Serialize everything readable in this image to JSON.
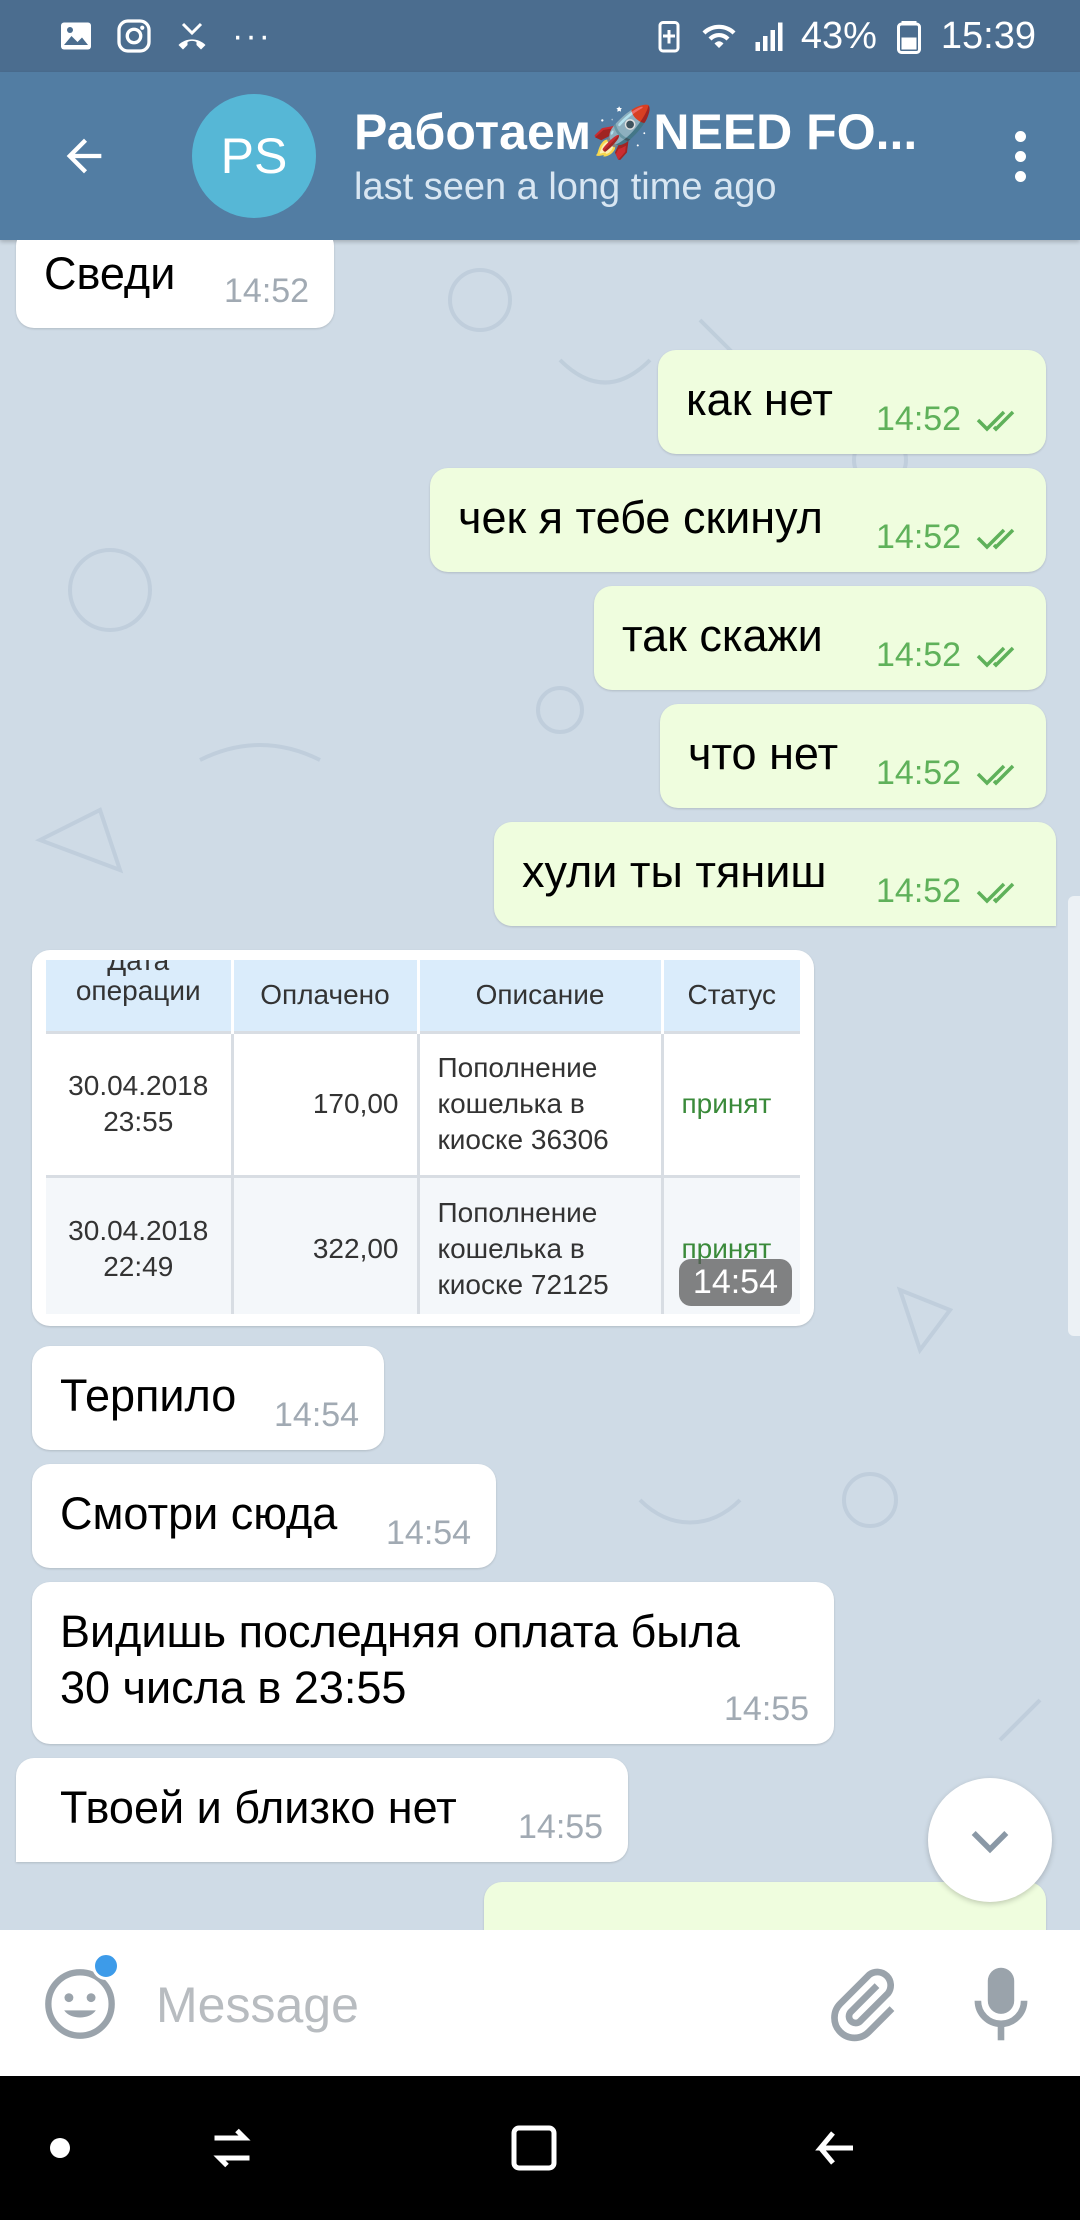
{
  "status_bar": {
    "battery_percent": "43%",
    "time": "15:39",
    "more": "···"
  },
  "header": {
    "avatar_initials": "PS",
    "title": "Работаем🚀NEED FO...",
    "subtitle": "last seen a long time ago"
  },
  "messages": [
    {
      "dir": "in",
      "text": "Сведи",
      "time": "14:52"
    },
    {
      "dir": "out",
      "text": "как нет",
      "time": "14:52"
    },
    {
      "dir": "out",
      "text": "чек я тебе скинул",
      "time": "14:52"
    },
    {
      "dir": "out",
      "text": "так скажи",
      "time": "14:52"
    },
    {
      "dir": "out",
      "text": "что нет",
      "time": "14:52"
    },
    {
      "dir": "out",
      "text": "хули ты тяниш",
      "time": "14:52"
    },
    {
      "dir": "in",
      "text": "Терпило",
      "time": "14:54"
    },
    {
      "dir": "in",
      "text": "Смотри сюда",
      "time": "14:54"
    },
    {
      "dir": "in",
      "text": "Видишь последняя оплата была",
      "text2": "30 числа в 23:55",
      "time": "14:55"
    },
    {
      "dir": "in",
      "text": "Твоей и близко нет",
      "time": "14:55"
    }
  ],
  "photo": {
    "time": "14:54",
    "headers": [
      "Дата\nоперации",
      "Оплачено",
      "Описание",
      "Статус"
    ],
    "rows": [
      {
        "date": "30.04.2018",
        "time": "23:55",
        "paid": "170,00",
        "desc1": "Пополнение",
        "desc2": "кошелька в",
        "desc3": "киоске 36306",
        "status": "принят"
      },
      {
        "date": "30.04.2018",
        "time": "22:49",
        "paid": "322,00",
        "desc1": "Пополнение",
        "desc2": "кошелька в",
        "desc3": "киоске 72125",
        "status": "принят"
      }
    ]
  },
  "input": {
    "placeholder": "Message"
  },
  "colors": {
    "header": "#527da3",
    "status_bar": "#4b6d8f",
    "outgoing_bubble": "#effdde",
    "incoming_bubble": "#ffffff",
    "chat_background": "#cfdbe6",
    "read_check": "#5fb15a"
  },
  "icons": [
    "image-icon",
    "instagram-icon",
    "missed-call-icon",
    "battery-saver-icon",
    "wifi-icon",
    "signal-icon",
    "battery-icon",
    "back-arrow-icon",
    "more-vert-icon",
    "double-check-icon",
    "chevron-down-icon",
    "emoji-icon",
    "paperclip-icon",
    "microphone-icon",
    "nav-dot-icon",
    "nav-recents-icon",
    "nav-home-icon",
    "nav-back-icon"
  ]
}
